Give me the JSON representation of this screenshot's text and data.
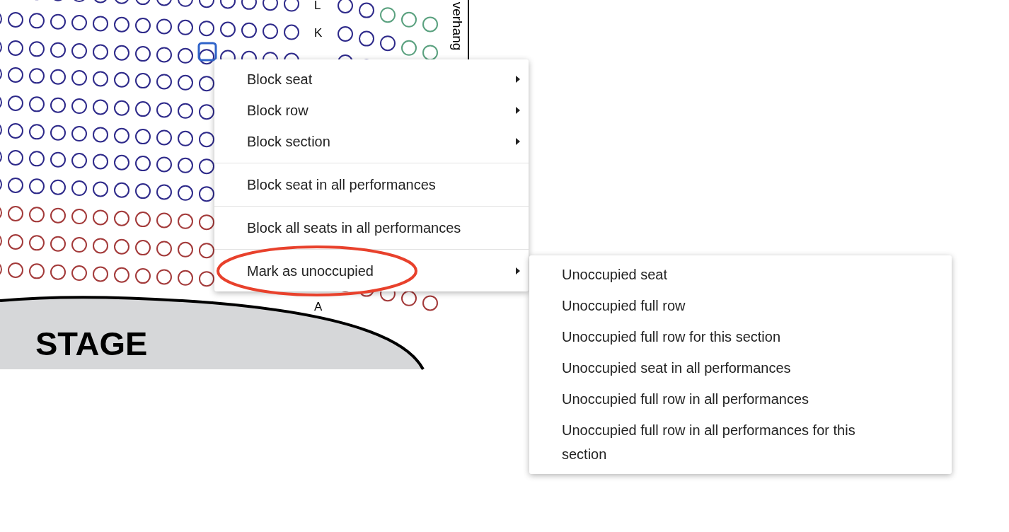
{
  "seat_map": {
    "sections": [
      {
        "color": "#2e2a8a"
      },
      {
        "color": "#a33a3a"
      },
      {
        "color": "#5aa17f"
      }
    ],
    "row_labels": [
      "L",
      "K",
      "A"
    ],
    "side_label": "verhang",
    "stage_label": "STAGE"
  },
  "context_menu": {
    "items": [
      {
        "kind": "item",
        "label": "Block seat",
        "has_submenu": true,
        "highlighted": false
      },
      {
        "kind": "item",
        "label": "Block row",
        "has_submenu": true,
        "highlighted": false
      },
      {
        "kind": "item",
        "label": "Block section",
        "has_submenu": true,
        "highlighted": false
      },
      {
        "kind": "separator"
      },
      {
        "kind": "item",
        "label": "Block seat in all performances",
        "has_submenu": false,
        "highlighted": false
      },
      {
        "kind": "separator"
      },
      {
        "kind": "item",
        "label": "Block all seats in all performances",
        "has_submenu": false,
        "highlighted": false
      },
      {
        "kind": "separator"
      },
      {
        "kind": "item",
        "label": "Mark as unoccupied",
        "has_submenu": true,
        "highlighted": true
      }
    ]
  },
  "submenu": {
    "items": [
      {
        "label": "Unoccupied seat"
      },
      {
        "label": "Unoccupied full row"
      },
      {
        "label": "Unoccupied full row for this section"
      },
      {
        "label": "Unoccupied seat in all performances"
      },
      {
        "label": "Unoccupied full row in all performances"
      },
      {
        "label": "Unoccupied full row in all performances for this section"
      }
    ]
  }
}
